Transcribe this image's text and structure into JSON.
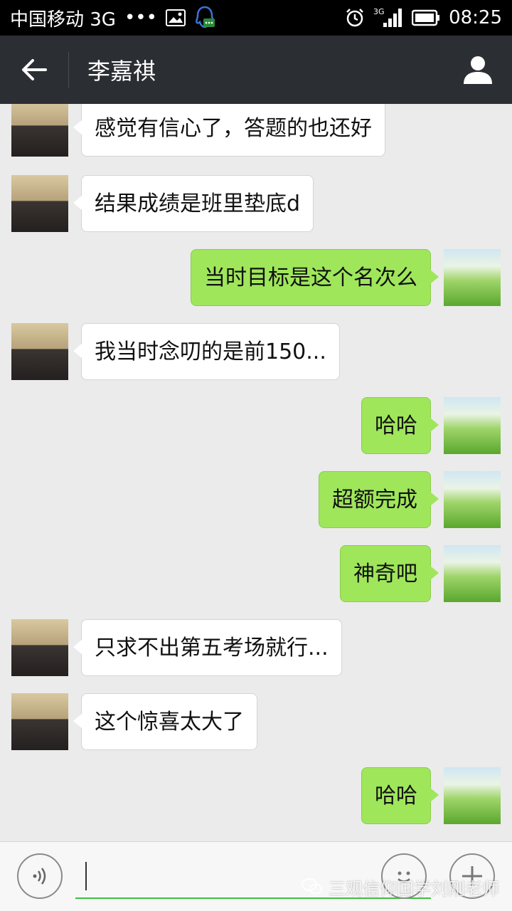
{
  "status_bar": {
    "carrier": "中国移动 3G",
    "dots": "•••",
    "network": "3G",
    "time": "08:25"
  },
  "header": {
    "title": "李嘉祺"
  },
  "messages": [
    {
      "side": "left",
      "text": "感觉有信心了，答题的也还好"
    },
    {
      "side": "left",
      "text": "结果成绩是班里垫底d"
    },
    {
      "side": "right",
      "text": "当时目标是这个名次么"
    },
    {
      "side": "left",
      "text": "我当时念叨的是前150..."
    },
    {
      "side": "right",
      "text": "哈哈"
    },
    {
      "side": "right",
      "text": "超额完成"
    },
    {
      "side": "right",
      "text": "神奇吧"
    },
    {
      "side": "left",
      "text": "只求不出第五考场就行..."
    },
    {
      "side": "left",
      "text": "这个惊喜太大了"
    },
    {
      "side": "right",
      "text": "哈哈"
    }
  ],
  "input": {
    "value": ""
  },
  "watermark": {
    "text": "三观信仰国学刘刚老师"
  },
  "icons": {
    "back": "back-arrow-icon",
    "profile": "person-icon",
    "voice": "voice-icon",
    "emoji": "emoji-icon",
    "plus": "plus-icon"
  },
  "colors": {
    "title_bar": "#2b2e33",
    "sent_bubble": "#9fe65b",
    "received_bubble": "#ffffff",
    "chat_background": "#ebebeb"
  }
}
